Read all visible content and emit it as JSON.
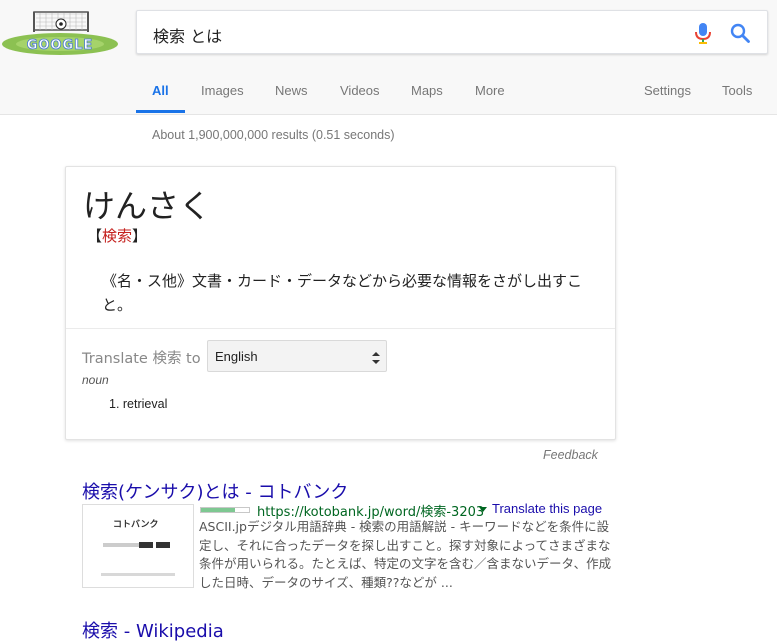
{
  "search": {
    "query": "検索 とは",
    "logo_text": "GOOGLE"
  },
  "tabs": [
    {
      "label": "All",
      "active": true
    },
    {
      "label": "Images"
    },
    {
      "label": "News"
    },
    {
      "label": "Videos"
    },
    {
      "label": "Maps"
    },
    {
      "label": "More"
    },
    {
      "label": "Settings"
    },
    {
      "label": "Tools"
    }
  ],
  "stats": "About 1,900,000,000 results (0.51 seconds)",
  "dictionary": {
    "headword": "けんさく",
    "kanji_open": "【",
    "kanji": "検索",
    "kanji_close": "】",
    "definition": "《名・ス他》文書・カード・データなどから必要な情報をさがし出すこと。",
    "translate_label": "Translate 検索 to",
    "language": "English",
    "part_of_speech": "noun",
    "sense_1": "1. retrieval"
  },
  "feedback": "Feedback",
  "results": [
    {
      "title": "検索(ケンサク)とは - コトバンク",
      "url": "https://kotobank.jp/word/検索-3203",
      "translate_link": "Translate this page",
      "thumbnail_title": "コトバンク",
      "snippet": "ASCII.jpデジタル用語辞典 - 検索の用語解説 - キーワードなどを条件に設定し、それに合ったデータを探し出すこと。探す対象によってさまざまな条件が用いられる。たとえば、特定の文字を含む／含まないデータ、作成した日時、データのサイズ、種類??などが ..."
    },
    {
      "title": "検索 - Wikipedia"
    }
  ],
  "colors": {
    "accent": "#1a73e8",
    "link": "#1a0dab",
    "url_green": "#006621",
    "kanji_red": "#c5221f"
  }
}
